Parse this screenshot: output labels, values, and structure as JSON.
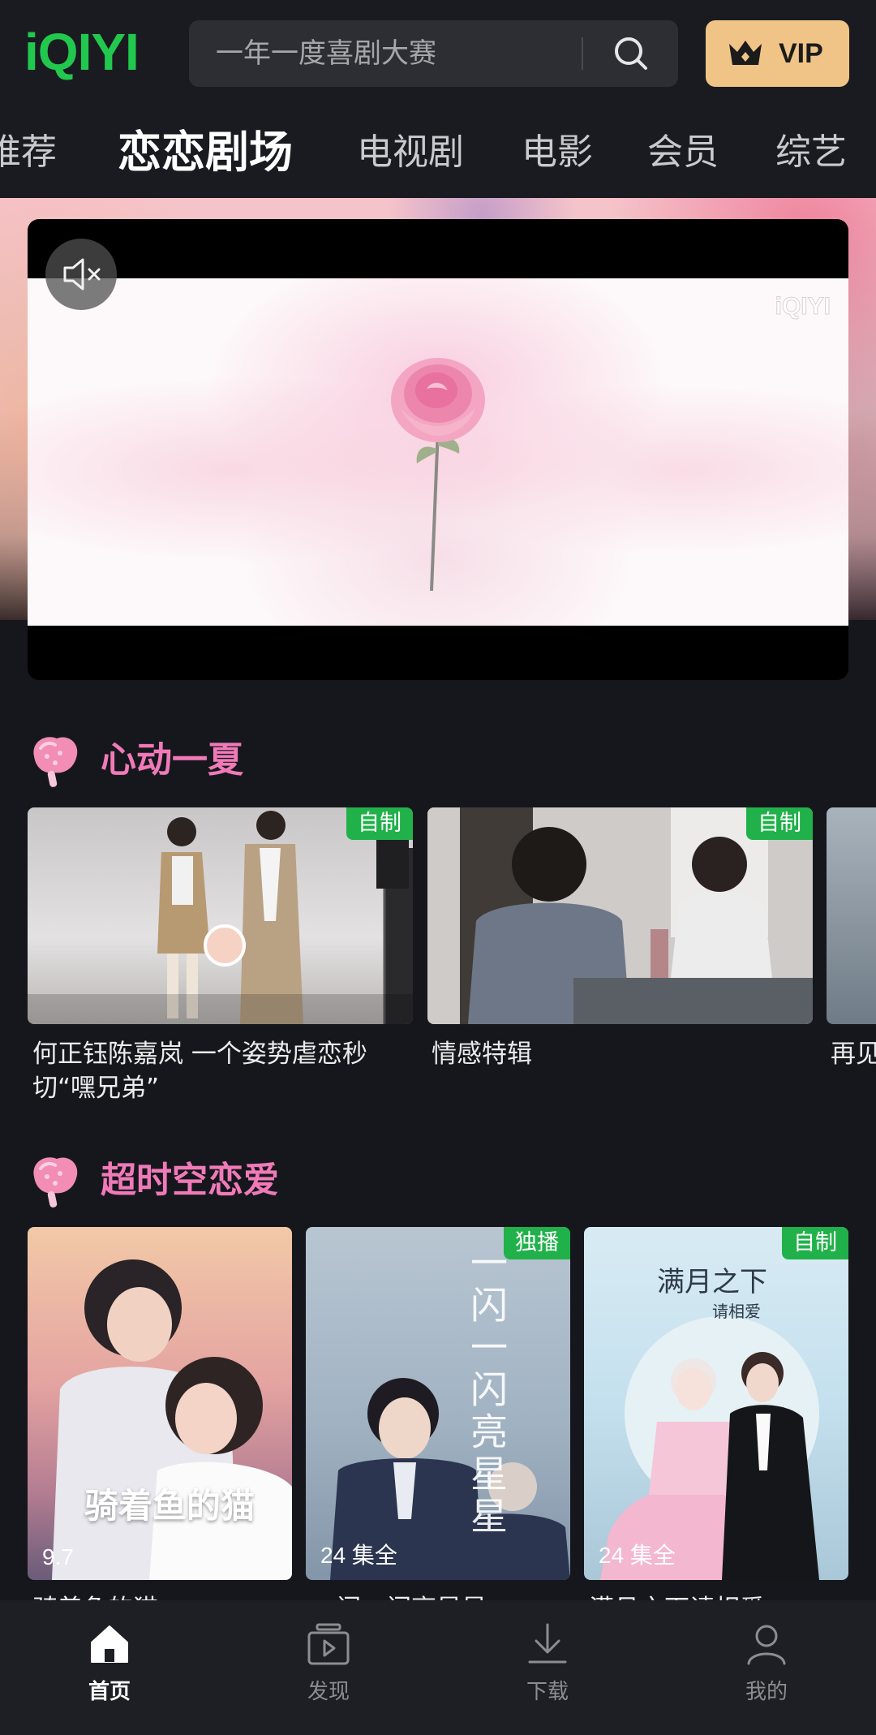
{
  "header": {
    "logo": "iQIYI",
    "search_placeholder": "一年一度喜剧大赛",
    "vip_label": "VIP"
  },
  "tabs": [
    "推荐",
    "恋恋剧场",
    "电视剧",
    "电影",
    "会员",
    "综艺"
  ],
  "active_tab": "恋恋剧场",
  "hero": {
    "watermark": "iQIYI"
  },
  "sections": [
    {
      "title": "心动一夏",
      "cards": [
        {
          "badge": "自制",
          "caption": "何正钰陈嘉岚 一个姿势虐恋秒切“嘿兄弟”"
        },
        {
          "badge": "自制",
          "caption": "情感特辑"
        },
        {
          "badge": "",
          "caption": "再见"
        }
      ]
    },
    {
      "title": "超时空恋爱",
      "cards": [
        {
          "badge": "",
          "overlay": "9.7",
          "caption": "骑着鱼的猫",
          "poster_title": "骑着鱼的猫"
        },
        {
          "badge": "独播",
          "overlay": "24 集全",
          "caption": "一闪一闪亮星星",
          "poster_title": "一闪一闪亮星星"
        },
        {
          "badge": "自制",
          "overlay": "24 集全",
          "caption": "满月之下请相爱",
          "poster_title": "满月之下",
          "poster_subtitle": "请相爱"
        }
      ]
    }
  ],
  "bottom_nav": [
    {
      "label": "首页",
      "icon": "home-icon",
      "active": true
    },
    {
      "label": "发现",
      "icon": "discover-icon",
      "active": false
    },
    {
      "label": "下载",
      "icon": "download-icon",
      "active": false
    },
    {
      "label": "我的",
      "icon": "profile-icon",
      "active": false
    }
  ],
  "colors": {
    "brand_green": "#22c84e",
    "vip_gold": "#f0c487",
    "section_pink": "#f07ab8",
    "badge_green": "#21b14a"
  }
}
